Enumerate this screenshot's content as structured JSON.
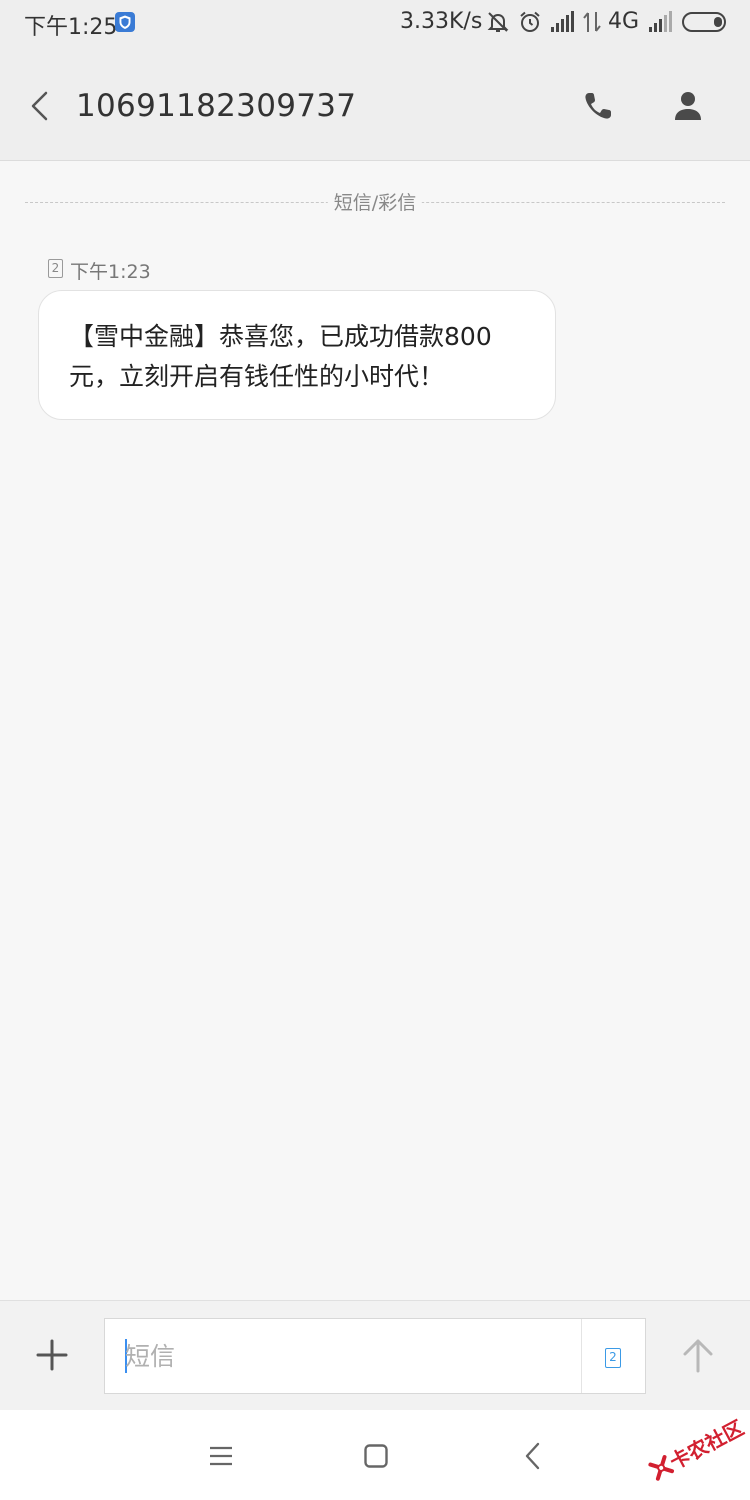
{
  "status_bar": {
    "time": "下午1:25",
    "net_speed": "3.33K/s",
    "network_type": "4G",
    "icons": [
      "shield-icon",
      "mute-icon",
      "alarm-icon",
      "signal-icon",
      "data-arrows-icon",
      "signal-icon",
      "battery-icon"
    ]
  },
  "header": {
    "title": "10691182309737",
    "icons": [
      "back-arrow-icon",
      "phone-icon",
      "contact-person-icon"
    ]
  },
  "conversation": {
    "divider_label": "短信/彩信",
    "messages": [
      {
        "sim_slot": "2",
        "time": "下午1:23",
        "text": "【雪中金融】恭喜您，已成功借款800元，立刻开启有钱任性的小时代！"
      }
    ]
  },
  "composer": {
    "add_icon": "plus-icon",
    "placeholder": "短信",
    "value": "",
    "sim_slot": "2",
    "send_icon": "send-arrow-icon"
  },
  "nav_bar": {
    "icons": [
      "menu-icon",
      "home-square-icon",
      "back-chevron-icon"
    ]
  },
  "watermark": {
    "text": "卡农社区"
  },
  "colors": {
    "header_bg": "#eeeeee",
    "page_bg": "#f7f7f7",
    "bubble_bg": "#ffffff",
    "accent_blue": "#3b9ae6",
    "status_shield": "#3a7bd5",
    "watermark_red": "#d22030"
  }
}
